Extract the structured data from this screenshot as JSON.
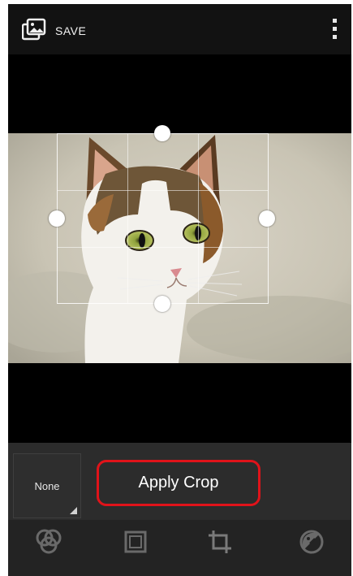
{
  "topbar": {
    "app_icon": "photo-editor-icon",
    "save_label": "SAVE",
    "overflow_icon": "more-vert-icon"
  },
  "editor": {
    "image": "cat-photo",
    "crop_grid": "rule-of-thirds",
    "handles": [
      "crop-handle-top",
      "crop-handle-left",
      "crop-handle-right",
      "crop-handle-bottom"
    ]
  },
  "options": {
    "aspect_selected": "None",
    "apply_label": "Apply Crop",
    "highlight_color": "#e0131a"
  },
  "toolbar": {
    "tools": [
      "filters-icon",
      "frame-icon",
      "crop-icon",
      "adjust-icon"
    ]
  },
  "colors": {
    "background": "#0c0c0c",
    "option_bar": "#2c2c2c",
    "toolbar": "#232323"
  }
}
